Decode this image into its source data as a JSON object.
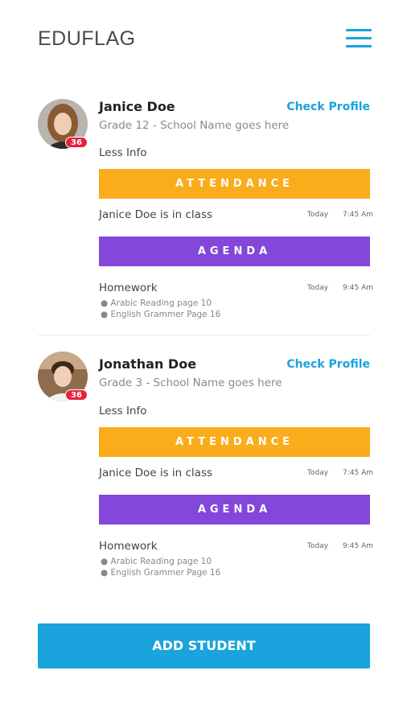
{
  "header": {
    "logo": "EDUFLAG",
    "menu_icon": "hamburger-menu-icon",
    "accent": "#1aa3dc"
  },
  "students": [
    {
      "name": "Janice Doe",
      "grade": "Grade 12 - School Name goes here",
      "badge": "36",
      "check_profile": "Check Profile",
      "less_info": "Less Info",
      "attendance_label": "ATTENDANCE",
      "attendance_status": "Janice Doe is in class",
      "attendance_day": "Today",
      "attendance_time": "7:45 Am",
      "agenda_label": "AGENDA",
      "homework_title": "Homework",
      "homework_day": "Today",
      "homework_time": "9:45 Am",
      "homework_items": [
        "● Arabic Reading page 10",
        "● English Grammer Page 16"
      ]
    },
    {
      "name": "Jonathan Doe",
      "grade": "Grade 3 - School Name goes here",
      "badge": "36",
      "check_profile": "Check Profile",
      "less_info": "Less Info",
      "attendance_label": "ATTENDANCE",
      "attendance_status": "Janice Doe is in class",
      "attendance_day": "Today",
      "attendance_time": "7:45 Am",
      "agenda_label": "AGENDA",
      "homework_title": "Homework",
      "homework_day": "Today",
      "homework_time": "9:45 Am",
      "homework_items": [
        "● Arabic Reading page 10",
        "● English Grammer Page 16"
      ]
    }
  ],
  "actions": {
    "add_student": "ADD STUDENT"
  },
  "colors": {
    "attendance": "#fbac1c",
    "agenda": "#8347d9",
    "badge": "#e8213a",
    "primary": "#1aa3dc"
  }
}
